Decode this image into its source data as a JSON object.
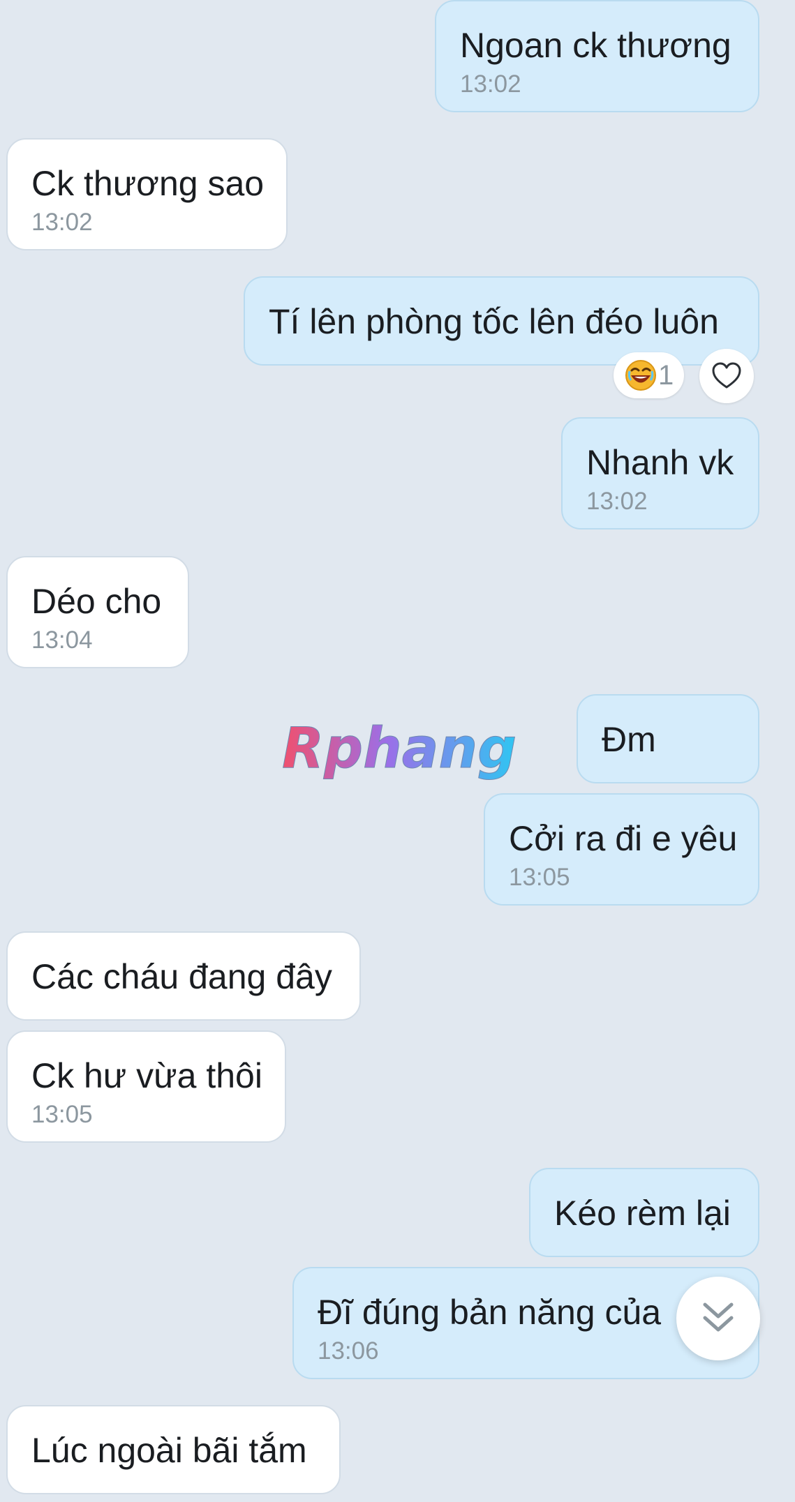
{
  "colors": {
    "background": "#e1e8f0",
    "sent_bubble": "#d5ecfb",
    "received_bubble": "#ffffff",
    "timestamp": "#8c979f"
  },
  "messages": [
    {
      "direction": "sent",
      "text": "Ngoan ck thương",
      "time": "13:02"
    },
    {
      "direction": "received",
      "text": "Ck thương sao",
      "time": "13:02"
    },
    {
      "direction": "sent",
      "text": "Tí lên phòng tốc lên đéo luôn",
      "time": ""
    },
    {
      "direction": "sent",
      "text": "Nhanh vk",
      "time": "13:02"
    },
    {
      "direction": "received",
      "text": "Déo cho",
      "time": "13:04"
    },
    {
      "direction": "sent",
      "text": "Đm",
      "time": ""
    },
    {
      "direction": "sent",
      "text": "Cởi ra đi e yêu",
      "time": "13:05"
    },
    {
      "direction": "received",
      "text": "Các cháu đang đây",
      "time": ""
    },
    {
      "direction": "received",
      "text": "Ck hư vừa thôi",
      "time": "13:05"
    },
    {
      "direction": "sent",
      "text": "Kéo rèm lại",
      "time": ""
    },
    {
      "direction": "sent",
      "text": "Đĩ đúng bản năng của",
      "time": "13:06"
    },
    {
      "direction": "received",
      "text": "Lúc ngoài bãi tắm",
      "time": ""
    }
  ],
  "reaction": {
    "emoji": "laughing-emoji-icon",
    "count": "1"
  },
  "like_button": {
    "icon": "heart-icon"
  },
  "watermark": {
    "text": "Rphang"
  },
  "scroll_button": {
    "icon": "double-chevron-down-icon"
  }
}
